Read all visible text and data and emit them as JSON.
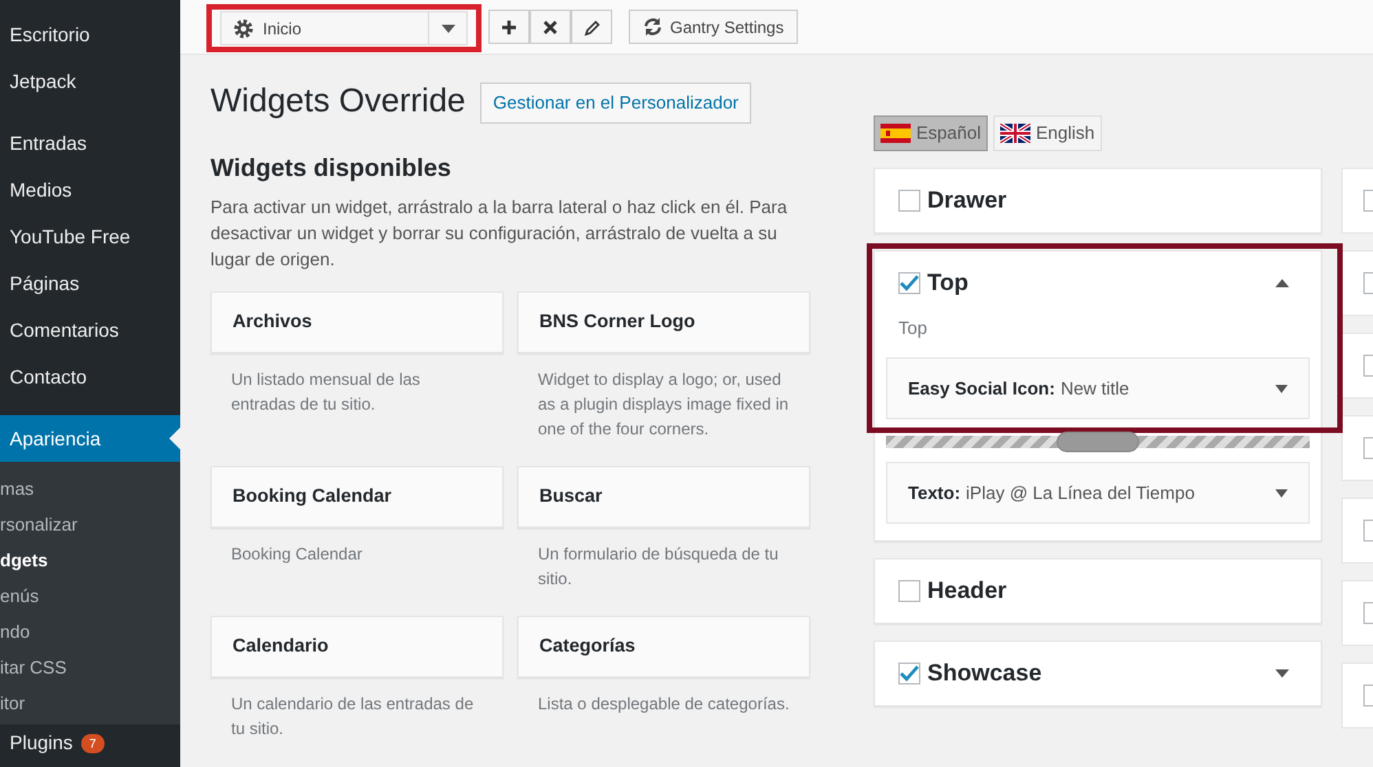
{
  "admin_menu": {
    "groups": [
      [
        {
          "label": "Escritorio",
          "selected": false
        },
        {
          "label": "Jetpack",
          "selected": false
        }
      ],
      [
        {
          "label": "Entradas",
          "selected": false
        },
        {
          "label": "Medios",
          "selected": false
        },
        {
          "label": "YouTube Free",
          "selected": false
        },
        {
          "label": "Páginas",
          "selected": false
        },
        {
          "label": "Comentarios",
          "selected": false
        },
        {
          "label": "Contacto",
          "selected": false
        }
      ],
      [
        {
          "label": "Apariencia",
          "selected": true,
          "children": [
            {
              "label": "mas",
              "selected": false
            },
            {
              "label": "rsonalizar",
              "selected": false
            },
            {
              "label": "dgets",
              "selected": true
            },
            {
              "label": "enús",
              "selected": false
            },
            {
              "label": "ndo",
              "selected": false
            },
            {
              "label": "itar CSS",
              "selected": false
            },
            {
              "label": "itor",
              "selected": false
            }
          ]
        },
        {
          "label": "Plugins",
          "selected": false,
          "badge": "7"
        }
      ]
    ]
  },
  "toolbar": {
    "highlighted": true,
    "page_select": {
      "value": "Inicio"
    },
    "gantry_button": "Gantry Settings"
  },
  "page": {
    "title": "Widgets Override",
    "customize_button": "Gestionar en el Personalizador"
  },
  "available_widgets": {
    "title": "Widgets disponibles",
    "description": "Para activar un widget, arrástralo a la barra lateral o haz click en él. Para desactivar un widget y borrar su configuración, arrástralo de vuelta a su lugar de origen.",
    "widgets": [
      {
        "title": "Archivos",
        "description": "Un listado mensual de las entradas de tu sitio."
      },
      {
        "title": "BNS Corner Logo",
        "description": "Widget to display a logo; or, used as a plugin displays image fixed in one of the four corners."
      },
      {
        "title": "Booking Calendar",
        "description": "Booking Calendar"
      },
      {
        "title": "Buscar",
        "description": "Un formulario de búsqueda de tu sitio."
      },
      {
        "title": "Calendario",
        "description": "Un calendario de las entradas de tu sitio."
      },
      {
        "title": "Categorías",
        "description": "Lista o desplegable de categorías."
      }
    ]
  },
  "languages": [
    {
      "label": "Español",
      "kind": "spain",
      "selected": true
    },
    {
      "label": "English",
      "kind": "uk",
      "selected": false
    }
  ],
  "sidebars": [
    {
      "title": "Drawer",
      "checked": false,
      "expanded": false,
      "highlighted": false
    },
    {
      "title": "Top",
      "checked": true,
      "expanded": true,
      "highlighted": true,
      "description": "Top",
      "widgets": [
        {
          "type": "Easy Social Icon:",
          "title": "New title"
        },
        {
          "type": "Texto:",
          "title": "iPlay @ La Línea del Tiempo"
        }
      ]
    },
    {
      "title": "Header",
      "checked": false,
      "expanded": false,
      "highlighted": false
    },
    {
      "title": "Showcase",
      "checked": true,
      "expanded": false,
      "highlighted": false
    }
  ],
  "sidebars_column_2": [
    {
      "checked": false
    },
    {
      "checked": false
    },
    {
      "checked": false
    },
    {
      "checked": false
    },
    {
      "checked": false
    },
    {
      "checked": false
    },
    {
      "checked": false
    }
  ]
}
